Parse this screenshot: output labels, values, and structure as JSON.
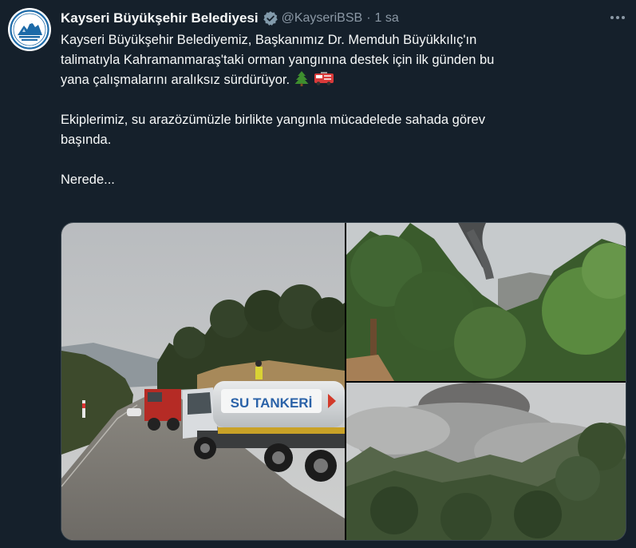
{
  "account": {
    "display_name": "Kayseri Büyükşehir Belediyesi",
    "handle": "@KayseriBSB",
    "separator": "·",
    "time": "1 sa",
    "verified": true,
    "avatar_icon": "kayseri-municipality-logo"
  },
  "tweet": {
    "paragraph1": [
      "Kayseri Büyükşehir Belediyemiz, Başkanımız Dr. Memduh Büyükkılıç'ın",
      "talimatıyla Kahramanmaraş'taki orman yangınına destek için ilk günden bu",
      "yana çalışmalarını aralıksız sürdürüyor."
    ],
    "emojis": [
      "evergreen-tree-emoji",
      "fire-engine-emoji"
    ],
    "paragraph2": [
      "Ekiplerimiz, su arazözümüzle birlikte yangınla mücadelede sahada görev",
      "başında."
    ],
    "paragraph3": "Nerede..."
  },
  "media": {
    "photos": [
      {
        "name": "water-tanker-truck-photo",
        "truck_label": "SU TANKERİ"
      },
      {
        "name": "forest-smoke-photo"
      },
      {
        "name": "forest-fire-smoke-photo"
      }
    ]
  },
  "colors": {
    "background": "#15202b",
    "text": "#f7f9f9",
    "secondary_text": "#8b98a5",
    "verified_badge": "#829aab"
  }
}
